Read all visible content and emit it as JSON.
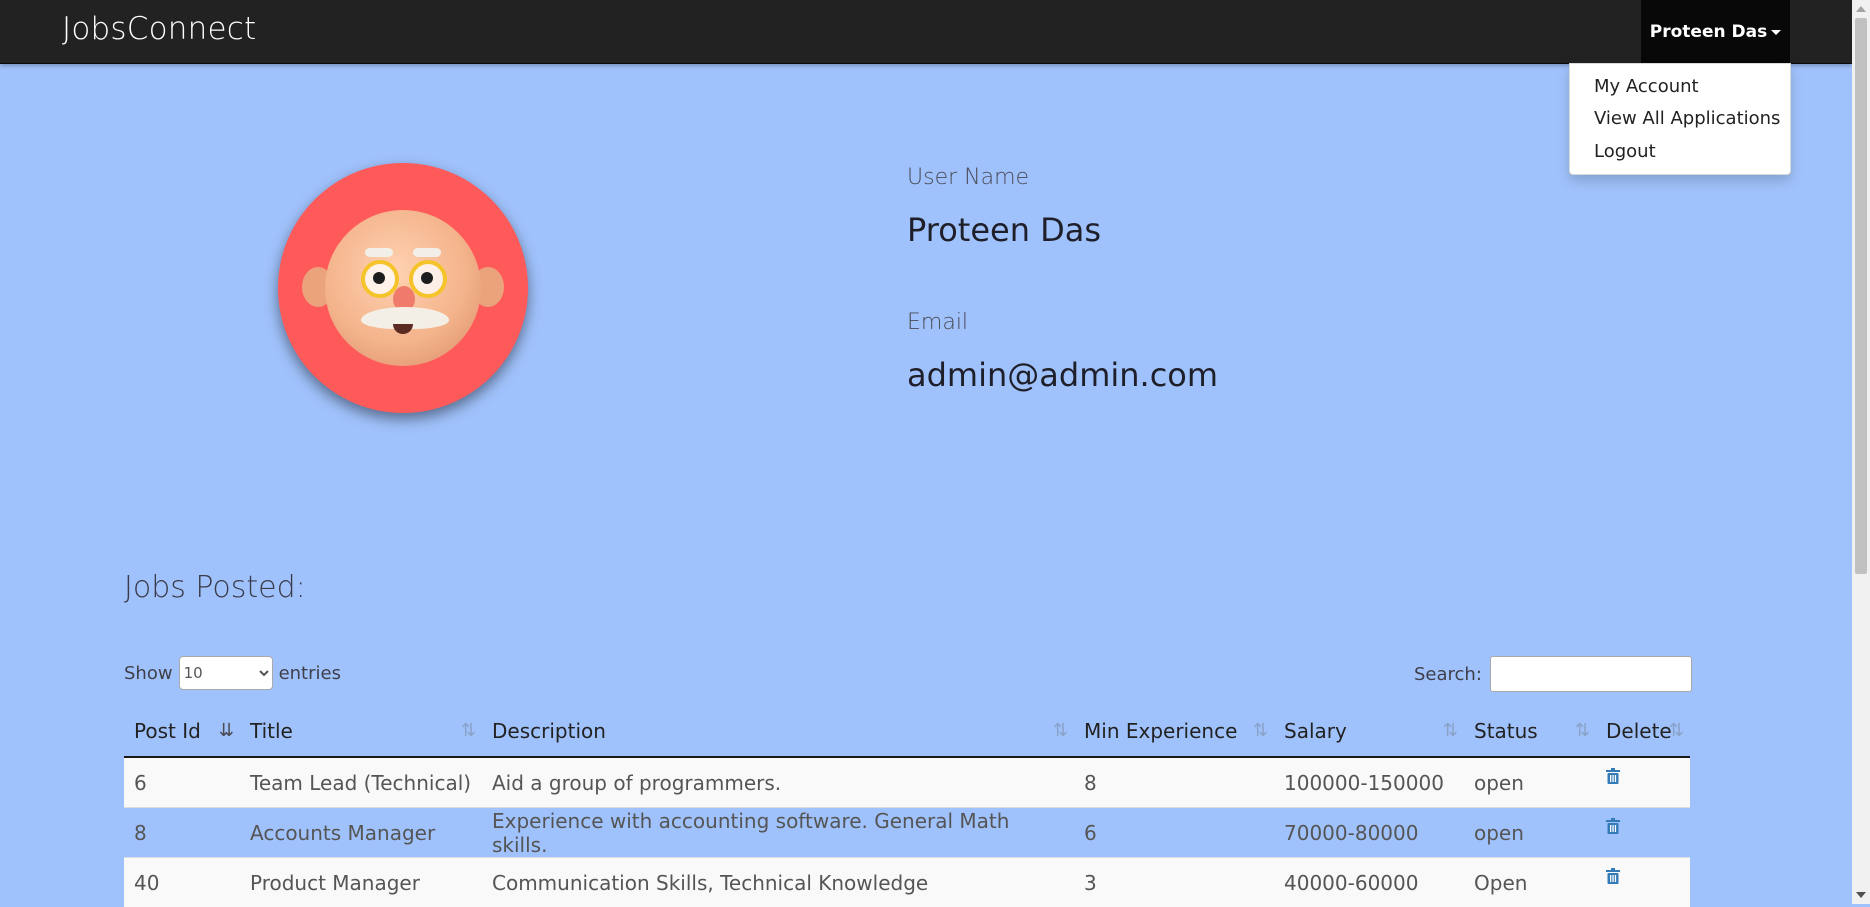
{
  "brand": "JobsConnect",
  "user_menu": {
    "label": "Proteen Das",
    "items": [
      "My Account",
      "View All Applications",
      "Logout"
    ]
  },
  "profile": {
    "username_label": "User Name",
    "username": "Proteen Das",
    "email_label": "Email",
    "email": "admin@admin.com"
  },
  "jobs": {
    "title": "Jobs Posted:",
    "show_label": "Show",
    "entries_value": "10",
    "entries_label": "entries",
    "search_label": "Search:",
    "columns": [
      "Post Id",
      "Title",
      "Description",
      "Min Experience",
      "Salary",
      "Status",
      "Delete"
    ],
    "rows": [
      {
        "id": "6",
        "title": "Team Lead (Technical)",
        "description": "Aid a group of programmers.",
        "min_exp": "8",
        "salary": "100000-150000",
        "status": "open"
      },
      {
        "id": "8",
        "title": "Accounts Manager",
        "description": "Experience with accounting software. General Math skills.",
        "min_exp": "6",
        "salary": "70000-80000",
        "status": "open"
      },
      {
        "id": "40",
        "title": "Product Manager",
        "description": "Communication Skills, Technical Knowledge",
        "min_exp": "3",
        "salary": "40000-60000",
        "status": "Open"
      }
    ]
  },
  "colors": {
    "page_bg": "#a0c2fc",
    "navbar_bg": "#222222",
    "avatar_bg": "#ff5a5a",
    "icon_blue": "#337ab7"
  }
}
